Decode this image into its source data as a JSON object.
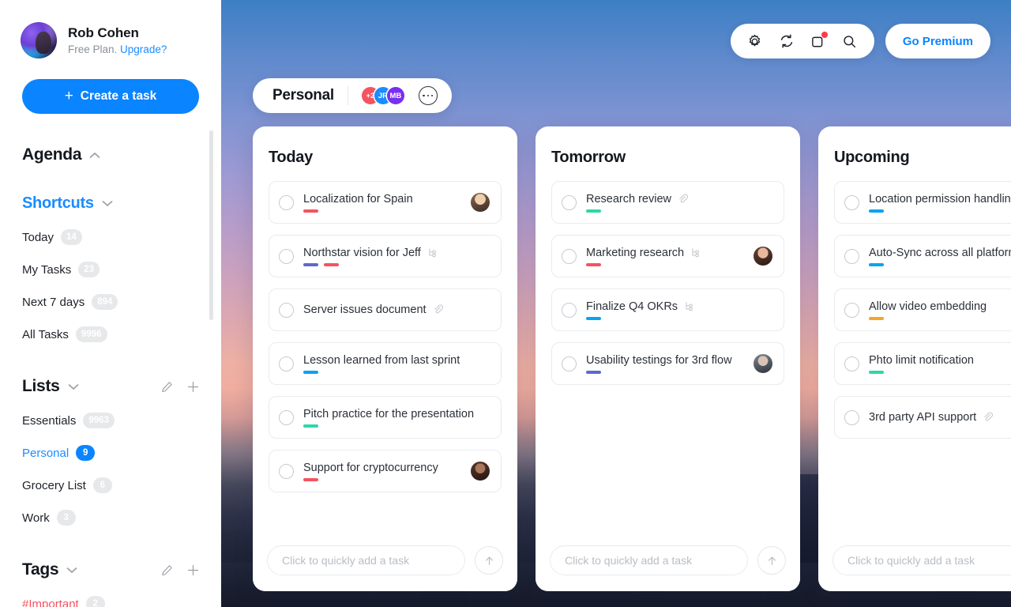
{
  "sidebar": {
    "profile": {
      "name": "Rob Cohen",
      "plan": "Free Plan.",
      "upgrade": "Upgrade?"
    },
    "create_task_label": "Create a task",
    "agenda": {
      "title": "Agenda"
    },
    "shortcuts": {
      "title": "Shortcuts",
      "items": [
        {
          "label": "Today",
          "count": "14"
        },
        {
          "label": "My Tasks",
          "count": "23"
        },
        {
          "label": "Next 7 days",
          "count": "894"
        },
        {
          "label": "All Tasks",
          "count": "9996"
        }
      ]
    },
    "lists": {
      "title": "Lists",
      "items": [
        {
          "label": "Essentials",
          "count": "9963",
          "active": false
        },
        {
          "label": "Personal",
          "count": "9",
          "active": true
        },
        {
          "label": "Grocery List",
          "count": "6",
          "active": false
        },
        {
          "label": "Work",
          "count": "3",
          "active": false
        }
      ]
    },
    "tags": {
      "title": "Tags",
      "items": [
        {
          "label": "#Important",
          "count": "2"
        }
      ]
    }
  },
  "toolbar": {
    "icons": [
      "gear-icon",
      "sync-icon",
      "notifications-icon",
      "search-icon"
    ],
    "premium_label": "Go Premium"
  },
  "board_header": {
    "name": "Personal",
    "avatars": [
      {
        "label": "+2",
        "color": "#f4535f"
      },
      {
        "label": "JR",
        "color": "#1a8cff"
      },
      {
        "label": "MB",
        "color": "#7a2ef0"
      }
    ]
  },
  "colors": {
    "accent": "#0a84ff",
    "tag_red": "#f4535f",
    "tag_blue": "#0aa3f0",
    "tag_indigo": "#5b6ad0",
    "tag_green": "#2ed6a8",
    "tag_orange": "#f5a623"
  },
  "columns": [
    {
      "title": "Today",
      "quick_add_placeholder": "Click to quickly add a task",
      "tasks": [
        {
          "title": "Localization for Spain",
          "tags": [
            "#f4535f"
          ],
          "icon": "",
          "avatar": "#d8b79a"
        },
        {
          "title": "Northstar vision for Jeff",
          "tags": [
            "#5b6ad0",
            "#f4535f"
          ],
          "icon": "subtask-icon",
          "avatar": ""
        },
        {
          "title": "Server issues document",
          "tags": [],
          "icon": "attachment-icon",
          "avatar": ""
        },
        {
          "title": "Lesson learned from last sprint",
          "tags": [
            "#0aa3f0"
          ],
          "icon": "",
          "avatar": ""
        },
        {
          "title": "Pitch practice for the presentation",
          "tags": [
            "#2ed6a8"
          ],
          "icon": "",
          "avatar": ""
        },
        {
          "title": "Support for cryptocurrency",
          "tags": [
            "#f4535f"
          ],
          "icon": "",
          "avatar": "#6b4436"
        }
      ]
    },
    {
      "title": "Tomorrow",
      "quick_add_placeholder": "Click to quickly add a task",
      "tasks": [
        {
          "title": "Research review",
          "tags": [
            "#2ed6a8"
          ],
          "icon": "attachment-icon",
          "avatar": ""
        },
        {
          "title": "Marketing research",
          "tags": [
            "#f4535f"
          ],
          "icon": "subtask-icon",
          "avatar": "#c98b7a"
        },
        {
          "title": "Finalize Q4 OKRs",
          "tags": [
            "#0aa3f0"
          ],
          "icon": "subtask-icon",
          "avatar": ""
        },
        {
          "title": "Usability testings for 3rd flow",
          "tags": [
            "#5b6ad0"
          ],
          "icon": "",
          "avatar": "#9aa3ad"
        }
      ]
    },
    {
      "title": "Upcoming",
      "quick_add_placeholder": "Click to quickly add a task",
      "tasks": [
        {
          "title": "Location permission handling",
          "tags": [
            "#0aa3f0"
          ],
          "icon": "",
          "avatar": ""
        },
        {
          "title": "Auto-Sync across all platforms",
          "tags": [
            "#0aa3f0"
          ],
          "icon": "",
          "avatar": ""
        },
        {
          "title": "Allow video embedding",
          "tags": [
            "#f5a623"
          ],
          "icon": "",
          "avatar": ""
        },
        {
          "title": "Phto limit notification",
          "tags": [
            "#2ed6a8"
          ],
          "icon": "",
          "avatar": ""
        },
        {
          "title": "3rd party API support",
          "tags": [],
          "icon": "attachment-icon",
          "avatar": ""
        }
      ]
    }
  ]
}
